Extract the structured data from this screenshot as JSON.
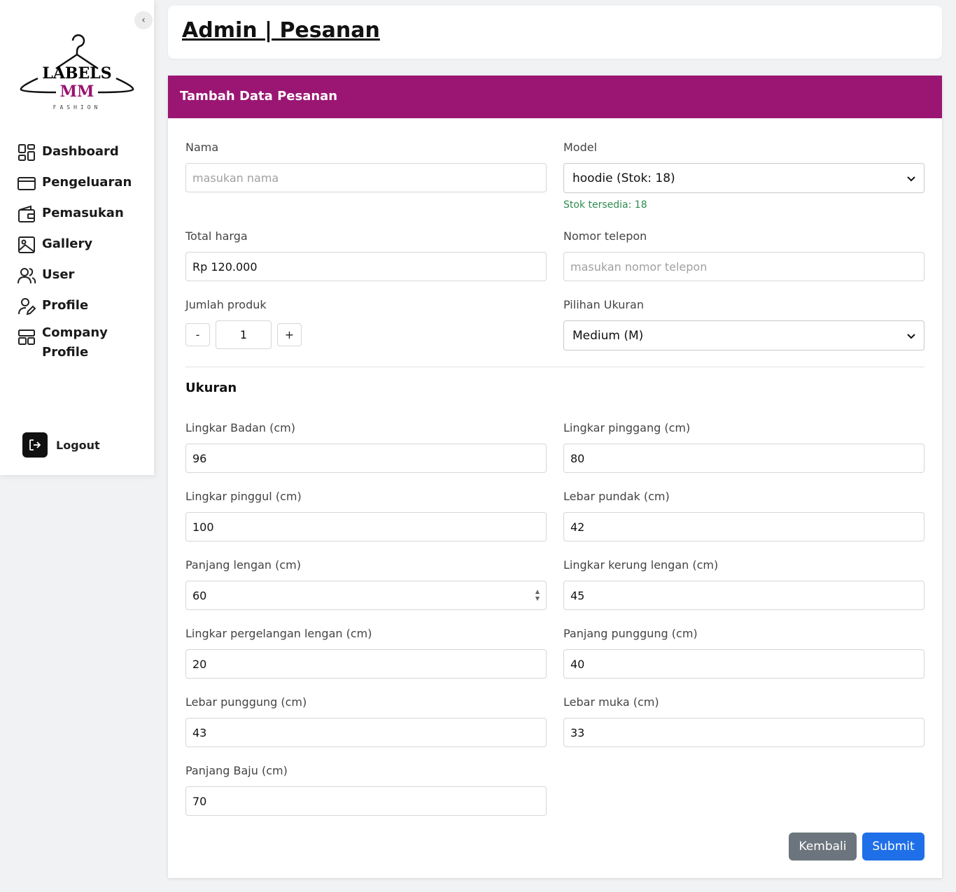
{
  "sidebar": {
    "logo": {
      "word": "LABELS",
      "mm": "MM",
      "tagline": "FASHION"
    },
    "items": [
      {
        "label": "Dashboard",
        "icon": "dashboard-icon"
      },
      {
        "label": "Pengeluaran",
        "icon": "credit-card-icon"
      },
      {
        "label": "Pemasukan",
        "icon": "wallet-icon"
      },
      {
        "label": "Gallery",
        "icon": "image-icon"
      },
      {
        "label": "User",
        "icon": "users-icon"
      },
      {
        "label": "Profile",
        "icon": "user-edit-icon"
      },
      {
        "label": "Company Profile",
        "label_line1": "Company",
        "label_line2": "Profile",
        "icon": "layout-icon"
      }
    ],
    "logout_label": "Logout"
  },
  "header": {
    "title": "Admin | Pesanan"
  },
  "form": {
    "title": "Tambah Data Pesanan",
    "nama": {
      "label": "Nama",
      "placeholder": "masukan nama",
      "value": ""
    },
    "model": {
      "label": "Model",
      "value": "hoodie (Stok: 18)",
      "stock_note": "Stok tersedia: 18"
    },
    "total_harga": {
      "label": "Total harga",
      "value": "Rp 120.000"
    },
    "nomor_telepon": {
      "label": "Nomor telepon",
      "placeholder": "masukan nomor telepon",
      "value": ""
    },
    "jumlah_produk": {
      "label": "Jumlah produk",
      "minus": "-",
      "value": "1",
      "plus": "+"
    },
    "pilihan_ukuran": {
      "label": "Pilihan Ukuran",
      "value": "Medium (M)"
    },
    "ukuran_title": "Ukuran",
    "measurements": [
      {
        "label": "Lingkar Badan (cm)",
        "value": "96"
      },
      {
        "label": "Lingkar pinggang (cm)",
        "value": "80"
      },
      {
        "label": "Lingkar pinggul (cm)",
        "value": "100"
      },
      {
        "label": "Lebar pundak (cm)",
        "value": "42"
      },
      {
        "label": "Panjang lengan (cm)",
        "value": "60"
      },
      {
        "label": "Lingkar kerung lengan (cm)",
        "value": "45"
      },
      {
        "label": "Lingkar pergelangan lengan (cm)",
        "value": "20"
      },
      {
        "label": "Panjang punggung (cm)",
        "value": "40"
      },
      {
        "label": "Lebar punggung (cm)",
        "value": "43"
      },
      {
        "label": "Lebar muka (cm)",
        "value": "33"
      },
      {
        "label": "Panjang Baju (cm)",
        "value": "70"
      }
    ],
    "back_label": "Kembali",
    "submit_label": "Submit"
  },
  "colors": {
    "accent": "#9b1673",
    "primary": "#1f6fe8",
    "secondary": "#6c757d",
    "success": "#2e8b4f"
  }
}
